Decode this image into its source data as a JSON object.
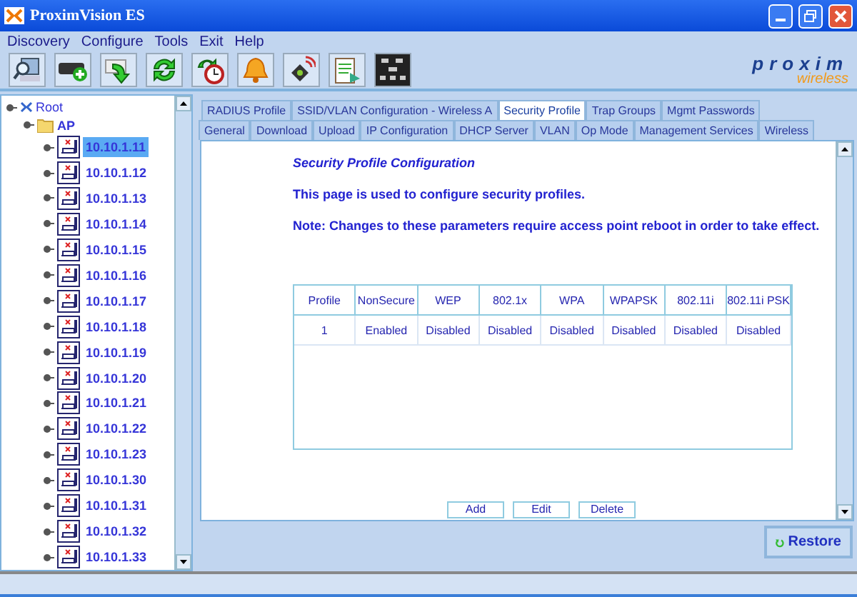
{
  "window": {
    "title": "ProximVision ES"
  },
  "menu": [
    {
      "label": "Discovery"
    },
    {
      "label": "Configure"
    },
    {
      "label": "Tools"
    },
    {
      "label": "Exit"
    },
    {
      "label": "Help"
    }
  ],
  "toolbar": [
    {
      "kind": "search"
    },
    {
      "kind": "add"
    },
    {
      "kind": "download"
    },
    {
      "kind": "refresh"
    },
    {
      "kind": "schedule"
    },
    {
      "kind": "alarm"
    },
    {
      "kind": "radio"
    },
    {
      "kind": "report"
    },
    {
      "kind": "topology"
    }
  ],
  "logo": {
    "name": "proxim",
    "tagline": "wireless"
  },
  "tree": {
    "label": "Root",
    "expanded": true,
    "children": [
      {
        "label": "AP",
        "expanded": true,
        "children": [
          {
            "label": "10.10.1.11",
            "selected": true
          },
          {
            "label": "10.10.1.12",
            "selected": false
          },
          {
            "label": "10.10.1.13",
            "selected": false
          },
          {
            "label": "10.10.1.14",
            "selected": false
          },
          {
            "label": "10.10.1.15",
            "selected": false
          },
          {
            "label": "10.10.1.16",
            "selected": false
          },
          {
            "label": "10.10.1.17",
            "selected": false
          },
          {
            "label": "10.10.1.18",
            "selected": false
          },
          {
            "label": "10.10.1.19",
            "selected": false
          },
          {
            "label": "10.10.1.20",
            "selected": false
          },
          {
            "label": "10.10.1.21",
            "selected": false
          },
          {
            "label": "10.10.1.22",
            "selected": false
          },
          {
            "label": "10.10.1.23",
            "selected": false
          },
          {
            "label": "10.10.1.30",
            "selected": false
          },
          {
            "label": "10.10.1.31",
            "selected": false
          },
          {
            "label": "10.10.1.32",
            "selected": false
          },
          {
            "label": "10.10.1.33",
            "selected": false
          }
        ]
      }
    ]
  },
  "tabs_top": [
    {
      "label": "RADIUS Profile",
      "selected": false
    },
    {
      "label": "SSID/VLAN Configuration - Wireless A",
      "selected": false
    },
    {
      "label": "Security Profile",
      "selected": true
    },
    {
      "label": "Trap Groups",
      "selected": false
    },
    {
      "label": "Mgmt Passwords",
      "selected": false
    }
  ],
  "tabs_bottom": [
    {
      "label": "General",
      "selected": false
    },
    {
      "label": "Download",
      "selected": false
    },
    {
      "label": "Upload",
      "selected": false
    },
    {
      "label": "IP Configuration",
      "selected": false
    },
    {
      "label": "DHCP Server",
      "selected": false
    },
    {
      "label": "VLAN",
      "selected": false
    },
    {
      "label": "Op Mode",
      "selected": false
    },
    {
      "label": "Management Services",
      "selected": false
    },
    {
      "label": "Wireless",
      "selected": false
    }
  ],
  "content": {
    "title": "Security Profile Configuration",
    "description": "This page is used to configure security profiles.",
    "note": "Note: Changes to these parameters require access point reboot in order to take effect."
  },
  "table": {
    "columns": [
      "Profile",
      "NonSecure",
      "WEP",
      "802.1x",
      "WPA",
      "WPAPSK",
      "802.11i",
      "802.11i PSK"
    ],
    "rows": [
      [
        "1",
        "Enabled",
        "Disabled",
        "Disabled",
        "Disabled",
        "Disabled",
        "Disabled",
        "Disabled"
      ]
    ]
  },
  "table_buttons": [
    "Add",
    "Edit",
    "Delete"
  ],
  "restore_button": {
    "label": "Restore"
  }
}
